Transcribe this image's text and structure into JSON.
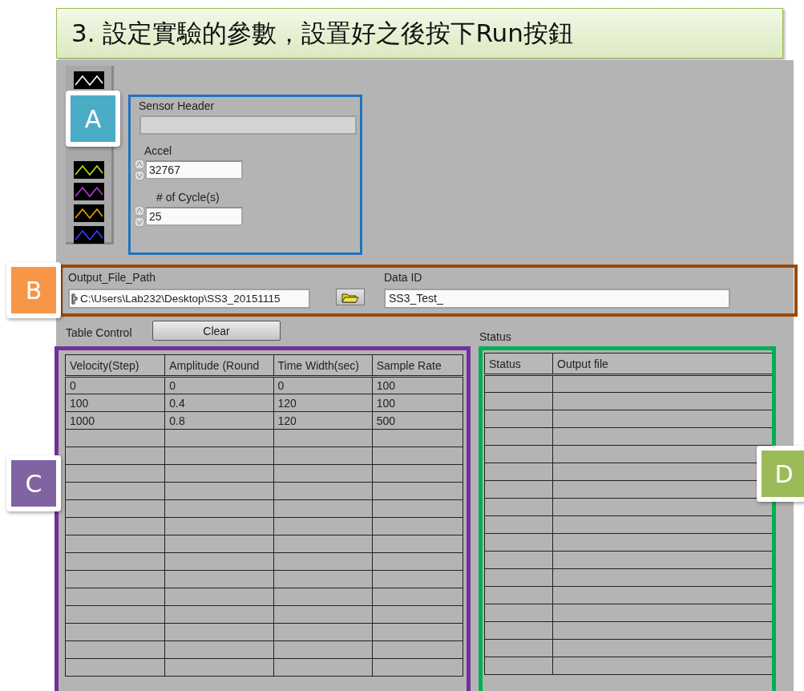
{
  "banner": {
    "title": "3. 設定實驗的參數，設置好之後按下Run按鈕"
  },
  "traces": [
    {
      "color": "#ffffff"
    },
    {
      "color": "#b5e61d"
    },
    {
      "color": "#b040d0"
    },
    {
      "color": "#f0a000"
    },
    {
      "color": "#3040ff"
    }
  ],
  "group_a": {
    "sensor_header": {
      "label": "Sensor Header"
    },
    "accel": {
      "label": "Accel",
      "value": "32767"
    },
    "cycles": {
      "label": "# of Cycle(s)",
      "value": "25"
    }
  },
  "group_b": {
    "output_path": {
      "label": "Output_File_Path",
      "value": "C:\\Users\\Lab232\\Desktop\\SS3_20151115"
    },
    "data_id": {
      "label": "Data ID",
      "value": "SS3_Test_"
    }
  },
  "table_control": {
    "label": "Table Control",
    "button": "Clear"
  },
  "status_label": "Status",
  "param_table": {
    "columns": [
      "Velocity(Step)",
      "Amplitude (Round",
      "Time Width(sec)",
      "Sample Rate"
    ],
    "rows": [
      [
        "0",
        "0",
        "0",
        "100"
      ],
      [
        "100",
        "0.4",
        "120",
        "100"
      ],
      [
        "1000",
        "0.8",
        "120",
        "500"
      ]
    ]
  },
  "status_table": {
    "columns": [
      "Status",
      "Output file"
    ]
  },
  "callouts": [
    {
      "letter": "A",
      "color": "#4bacc6"
    },
    {
      "letter": "B",
      "color": "#f79646"
    },
    {
      "letter": "C",
      "color": "#8064a2"
    },
    {
      "letter": "D",
      "color": "#9bbb59"
    }
  ]
}
